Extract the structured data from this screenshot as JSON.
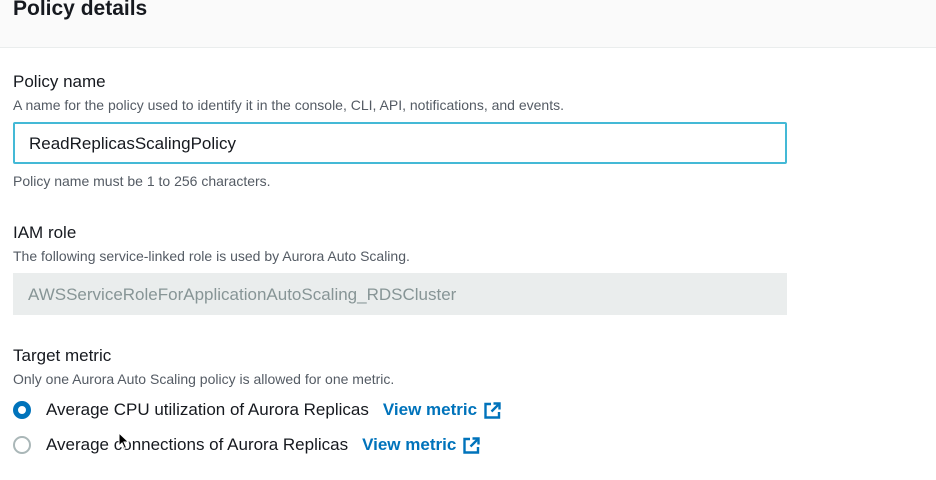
{
  "header": {
    "title": "Policy details"
  },
  "policy_name": {
    "label": "Policy name",
    "description": "A name for the policy used to identify it in the console, CLI, API, notifications, and events.",
    "value": "ReadReplicasScalingPolicy",
    "constraint": "Policy name must be 1 to 256 characters."
  },
  "iam_role": {
    "label": "IAM role",
    "description": "The following service-linked role is used by Aurora Auto Scaling.",
    "value": "AWSServiceRoleForApplicationAutoScaling_RDSCluster"
  },
  "target_metric": {
    "label": "Target metric",
    "description": "Only one Aurora Auto Scaling policy is allowed for one metric.",
    "options": [
      {
        "label": "Average CPU utilization of Aurora Replicas",
        "link": "View metric",
        "selected": true
      },
      {
        "label": "Average connections of Aurora Replicas",
        "link": "View metric",
        "selected": false
      }
    ]
  },
  "colors": {
    "accent": "#0073bb",
    "focus_border": "#44b9d6",
    "muted_text": "#545b64"
  },
  "icons": {
    "external_link": "external-link-icon",
    "pointer": "mouse-pointer-icon"
  }
}
